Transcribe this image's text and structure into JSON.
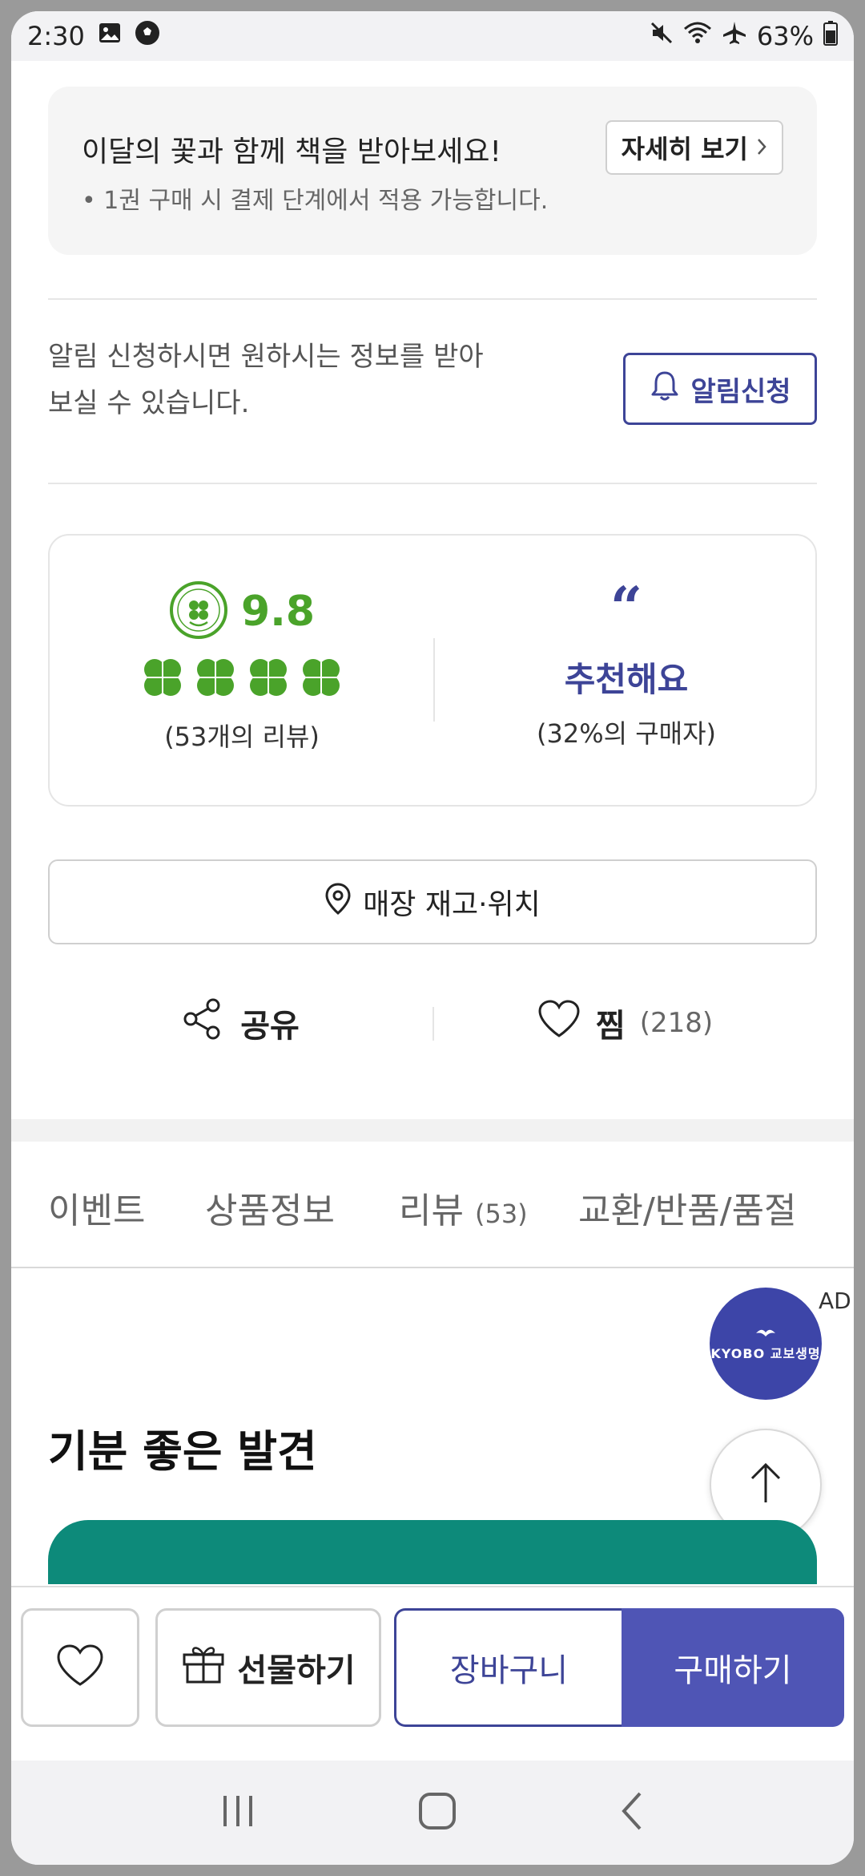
{
  "status_bar": {
    "time": "2:30",
    "battery": "63%",
    "icons": [
      "image-icon",
      "soccer-ball-icon",
      "mute-icon",
      "wifi-icon",
      "airplane-icon",
      "battery-icon"
    ]
  },
  "promo": {
    "title": "이달의 꽃과 함께 책을 받아보세요!",
    "note": "• 1권 구매 시 결제 단계에서 적용 가능합니다.",
    "detail_button": "자세히 보기"
  },
  "alarm": {
    "line1": "알림 신청하시면 원하시는 정보를 받아",
    "line2": "보실 수 있습니다.",
    "button": "알림신청"
  },
  "rating": {
    "score": "9.8",
    "clover_count": 4,
    "review_count_number": "53",
    "review_count_text": "개의 리뷰)",
    "recommend_label": "추천해요",
    "buyer_pct": "32%",
    "buyer_text": "의 구매자)"
  },
  "store_button": "매장 재고·위치",
  "share": {
    "share_label": "공유",
    "wish_label": "찜",
    "wish_count": "(218)"
  },
  "tabs": [
    {
      "label": "이벤트"
    },
    {
      "label": "상품정보"
    },
    {
      "label": "리뷰",
      "count": "(53)"
    },
    {
      "label": "교환/반품/품절"
    }
  ],
  "section_title": "기분 좋은 발견",
  "ad": {
    "label": "AD",
    "brand": "KYOBO 교보생명"
  },
  "bottom_bar": {
    "gift": "선물하기",
    "cart": "장바구니",
    "buy": "구매하기"
  },
  "colors": {
    "primary": "#3d4497",
    "buy": "#4f55b5",
    "clover_green": "#4aa32a",
    "teal_banner": "#0d8a7a"
  }
}
